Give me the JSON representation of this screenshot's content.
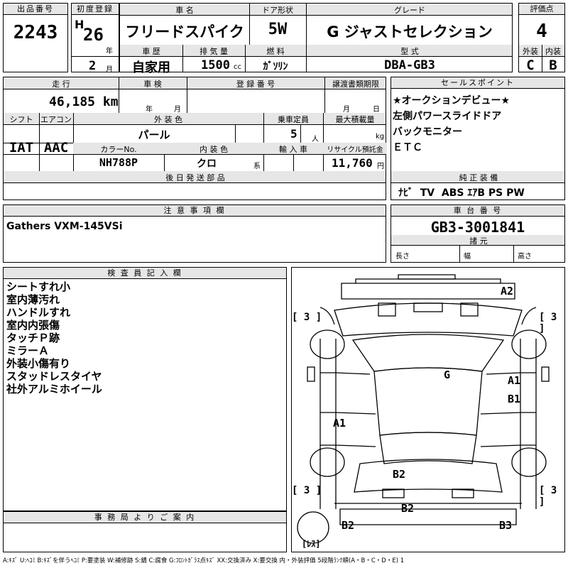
{
  "header": {
    "lot_label": "出品番号",
    "lot_no": "2243",
    "first_reg_label": "初度登録",
    "era": "H",
    "year": "26",
    "year_unit": "年",
    "month": "2",
    "month_unit": "月",
    "name_label": "車 名",
    "car_name": "フリードスパイク",
    "door_label": "ドア形状",
    "door": "5W",
    "grade_label": "グレード",
    "grade": "G ジャストセレクション",
    "score_label": "評価点",
    "score": "4",
    "history_label": "車 歴",
    "history": "自家用",
    "disp_label": "排 気 量",
    "disp": "1500",
    "disp_unit": "cc",
    "fuel_label": "燃 料",
    "fuel": "ｶﾞｿﾘﾝ",
    "model_label": "型 式",
    "model": "DBA-GB3",
    "ext_label": "外装",
    "ext": "C",
    "int_label": "内装",
    "int": "B"
  },
  "row2": {
    "mileage_label": "走 行",
    "mileage": "46,185 km",
    "inspect_label": "車 検",
    "inspect_year": "年",
    "inspect_month": "月",
    "reg_label": "登 録 番 号",
    "transfer_label": "譲渡書類期限",
    "transfer_month": "月",
    "transfer_day": "日",
    "shift_label": "シフト",
    "shift": "IAT",
    "ac_label": "エアコン",
    "ac": "AAC",
    "color_label": "外 装 色",
    "color": "パール",
    "capacity_label": "乗車定員",
    "capacity": "5",
    "capacity_unit": "人",
    "load_label": "最大積載量",
    "load_unit": "kg",
    "colorno_label": "カラーNo.",
    "colorno": "NH788P",
    "intcolor_label": "内 装 色",
    "intcolor": "クロ",
    "intcolor_unit": "系",
    "import_label": "輸 入 車",
    "recycle_label": "リサイクル預託金",
    "recycle": "11,760",
    "recycle_unit": "円",
    "later_label": "後 日 発 送 部 品"
  },
  "sales": {
    "label": "セールスポイント",
    "lines": [
      "★オークションデビュー★",
      "左側パワースライドドア",
      "バックモニター",
      "ＥＴＣ"
    ]
  },
  "equipment": {
    "label": "純 正 装 備",
    "items": "ﾅﾋﾞ  TV  ABS ｴｱB PS PW"
  },
  "notes": {
    "label": "注 意 事 項 欄",
    "text": "Gathers VXM-145VSi"
  },
  "chassis": {
    "label": "車 台 番 号",
    "value": "GB3-3001841",
    "dims_label": "諸 元",
    "length": "長さ",
    "width": "幅",
    "height": "高さ"
  },
  "inspector": {
    "label": "検 査 員 記 入 欄",
    "lines": [
      "シートすれ小",
      "室内薄汚れ",
      "ハンドルすれ",
      "室内内張傷",
      "タッチＰ跡",
      "ミラーＡ",
      "外装小傷有り",
      "スタッドレスタイヤ",
      "社外アルミホイール"
    ]
  },
  "office": {
    "label": "事 務 局 よ り ご 案 内"
  },
  "diagram": {
    "marks": {
      "a2_top": "A2",
      "g": "G",
      "a1_right": "A1",
      "b1_right": "B1",
      "a1_left": "A1",
      "b2_center": "B2",
      "b2_bottom": "B2",
      "b2_left": "B2",
      "b3_right": "B3"
    },
    "tire_fl": "[ 3 ]",
    "tire_fr": "[ 3 ]",
    "tire_rl": "[ 3 ]",
    "tire_rr": "[ 3 ]",
    "spare": "[ﾚｽ]"
  },
  "legend": "A:ｷｽﾞ U:ﾍｺﾐ B:ｷｽﾞを伴うﾍｺﾐ P:要塗装 W:補修跡 S:錆 C:腐食 G:ﾌﾛﾝﾄｶﾞﾗｽ点ｷｽﾞ XX:交換済み X:要交換  内・外装評価 5段階ﾗﾝｸ順(A・B・C・D・E) 1"
}
